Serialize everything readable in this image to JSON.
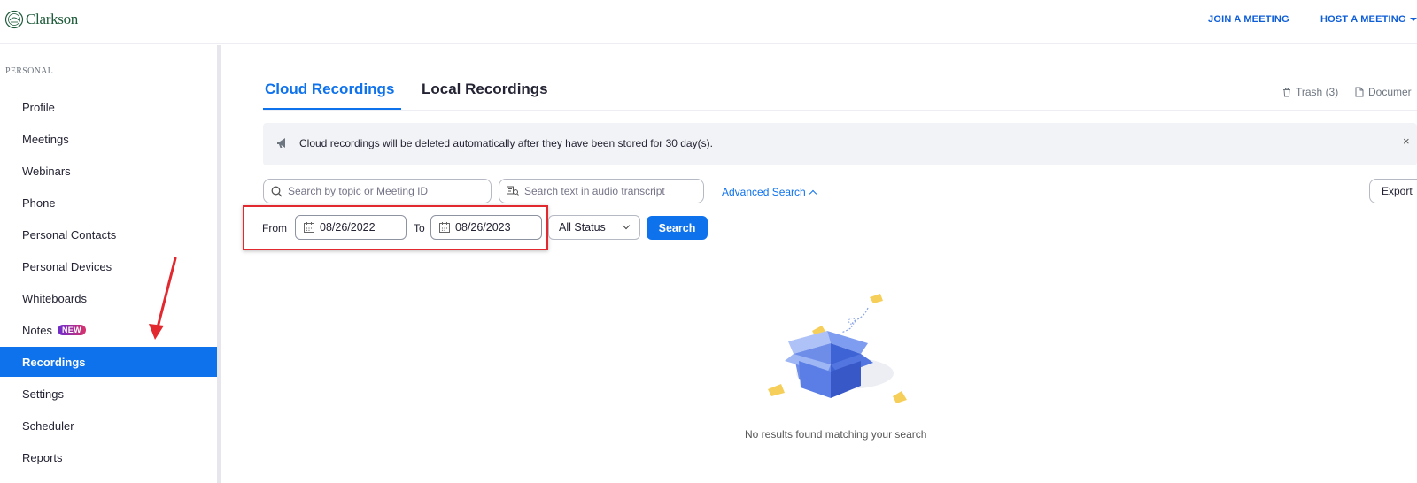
{
  "header": {
    "logo_text": "Clarkson",
    "join_label": "JOIN A MEETING",
    "host_label": "HOST A MEETING",
    "brand_color": "#0E72ED"
  },
  "sidebar": {
    "section_label": "PERSONAL",
    "items": [
      {
        "label": "Profile"
      },
      {
        "label": "Meetings"
      },
      {
        "label": "Webinars"
      },
      {
        "label": "Phone"
      },
      {
        "label": "Personal Contacts"
      },
      {
        "label": "Personal Devices"
      },
      {
        "label": "Whiteboards"
      },
      {
        "label": "Notes",
        "badge": "NEW"
      },
      {
        "label": "Recordings",
        "active": true
      },
      {
        "label": "Settings"
      },
      {
        "label": "Scheduler"
      },
      {
        "label": "Reports"
      }
    ]
  },
  "tabs": {
    "cloud": "Cloud Recordings",
    "local": "Local Recordings",
    "trash": "Trash (3)",
    "documents": "Documer"
  },
  "notice": {
    "text": "Cloud recordings will be deleted automatically after they have been stored for 30 day(s).",
    "close": "×"
  },
  "filters": {
    "search_topic_placeholder": "Search by topic or Meeting ID",
    "search_audio_placeholder": "Search text in audio transcript",
    "advanced_search": "Advanced Search",
    "export": "Export",
    "from_label": "From",
    "from_date": "08/26/2022",
    "to_label": "To",
    "to_date": "08/26/2023",
    "status_value": "All Status",
    "search_button": "Search"
  },
  "empty_state": {
    "message": "No results found matching your search"
  }
}
